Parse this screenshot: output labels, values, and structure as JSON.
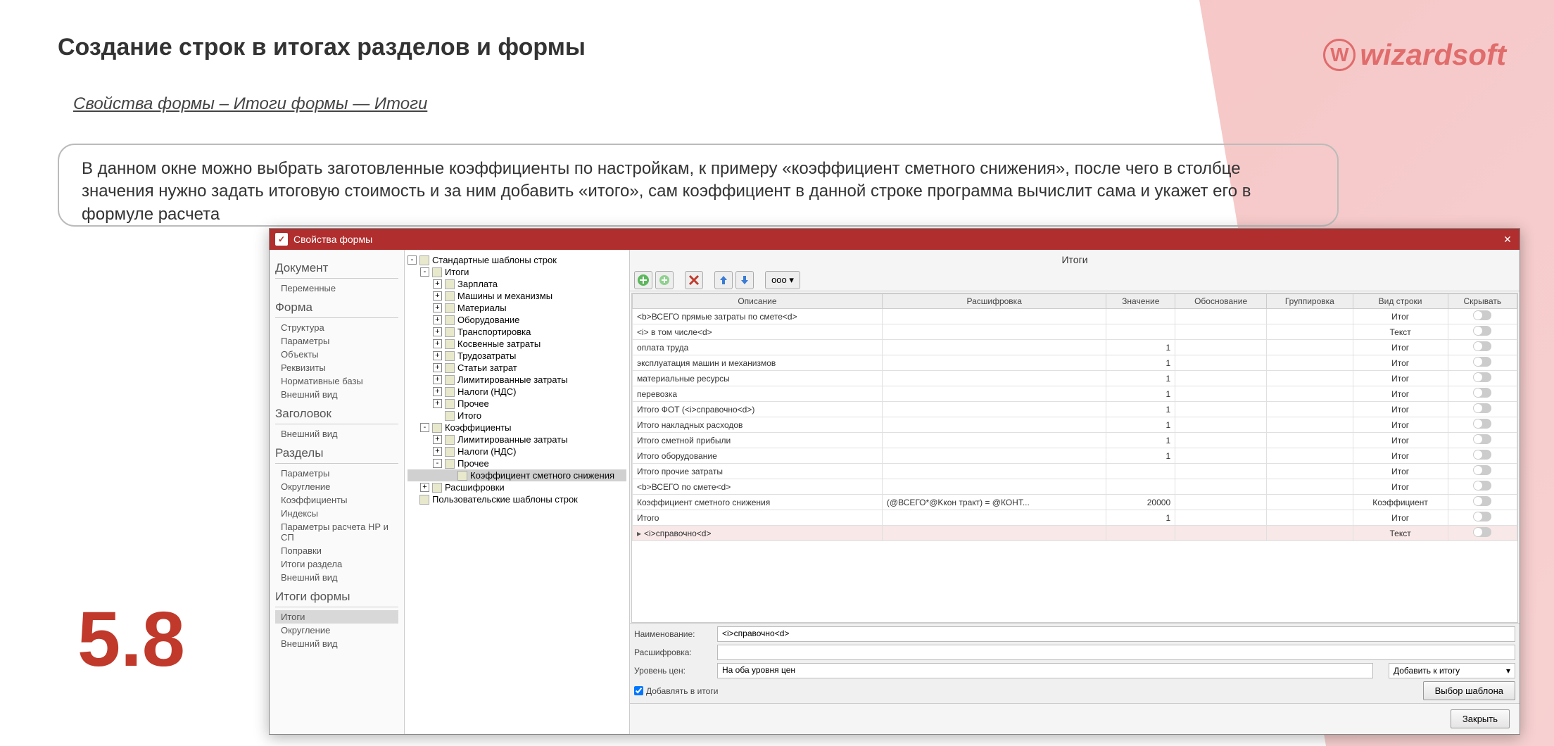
{
  "page": {
    "title": "Создание строк в итогах разделов и формы",
    "breadcrumb": "Свойства формы – Итоги формы — Итоги",
    "logo": "wizardsoft",
    "logo_glyph": "W",
    "description": "В данном окне можно выбрать заготовленные коэффициенты по настройкам, к примеру «коэффициент сметного снижения», после чего в столбце значения нужно задать  итоговую стоимость и за ним добавить «итого», сам коэффициент в данной строке программа вычислит сама и укажет его в формуле расчета",
    "step_number": "5.8"
  },
  "dialog": {
    "title": "Свойства формы",
    "nav": {
      "sections": [
        {
          "heading": "Документ",
          "items": [
            "Переменные"
          ]
        },
        {
          "heading": "Форма",
          "items": [
            "Структура",
            "Параметры",
            "Объекты",
            "Реквизиты",
            "Нормативные базы",
            "Внешний вид"
          ]
        },
        {
          "heading": "Заголовок",
          "items": [
            "Внешний вид"
          ]
        },
        {
          "heading": "Разделы",
          "items": [
            "Параметры",
            "Округление",
            "Коэффициенты",
            "Индексы",
            "Параметры расчета НР и СП",
            "   Поправки",
            "Итоги раздела",
            "Внешний вид"
          ]
        },
        {
          "heading": "Итоги формы",
          "items": [
            "Итоги",
            "Округление",
            "Внешний вид"
          ],
          "selected": "Итоги"
        }
      ]
    },
    "tree": [
      {
        "lvl": 0,
        "toggle": "-",
        "label": "Стандартные шаблоны строк"
      },
      {
        "lvl": 1,
        "toggle": "-",
        "label": "Итоги"
      },
      {
        "lvl": 2,
        "toggle": "+",
        "label": "Зарплата"
      },
      {
        "lvl": 2,
        "toggle": "+",
        "label": "Машины и механизмы"
      },
      {
        "lvl": 2,
        "toggle": "+",
        "label": "Материалы"
      },
      {
        "lvl": 2,
        "toggle": "+",
        "label": "Оборудование"
      },
      {
        "lvl": 2,
        "toggle": "+",
        "label": "Транспортировка"
      },
      {
        "lvl": 2,
        "toggle": "+",
        "label": "Косвенные затраты"
      },
      {
        "lvl": 2,
        "toggle": "+",
        "label": "Трудозатраты"
      },
      {
        "lvl": 2,
        "toggle": "+",
        "label": "Статьи затрат"
      },
      {
        "lvl": 2,
        "toggle": "+",
        "label": "Лимитированные затраты"
      },
      {
        "lvl": 2,
        "toggle": "+",
        "label": "Налоги (НДС)"
      },
      {
        "lvl": 2,
        "toggle": "+",
        "label": "Прочее"
      },
      {
        "lvl": 2,
        "toggle": "",
        "label": "Итого"
      },
      {
        "lvl": 1,
        "toggle": "-",
        "label": "Коэффициенты"
      },
      {
        "lvl": 2,
        "toggle": "+",
        "label": "Лимитированные затраты"
      },
      {
        "lvl": 2,
        "toggle": "+",
        "label": "Налоги (НДС)"
      },
      {
        "lvl": 2,
        "toggle": "-",
        "label": "Прочее"
      },
      {
        "lvl": 3,
        "toggle": "",
        "label": "Коэффициент сметного снижения",
        "hl": true
      },
      {
        "lvl": 1,
        "toggle": "+",
        "label": "Расшифровки"
      },
      {
        "lvl": 0,
        "toggle": "",
        "label": "Пользовательские шаблоны строк"
      }
    ],
    "main": {
      "title": "Итоги",
      "toolbar_ellipsis": "ooo ▾",
      "columns": [
        "Описание",
        "Расшифровка",
        "Значение",
        "Обоснование",
        "Группировка",
        "Вид строки",
        "Скрывать"
      ],
      "rows": [
        {
          "desc": "<b>ВСЕГО прямые затраты по смете<d>",
          "val": "",
          "group": "",
          "kind": "Итог"
        },
        {
          "desc": "<i>   в том числе<d>",
          "val": "",
          "group": "",
          "kind": "Текст"
        },
        {
          "desc": "оплата труда",
          "val": "1",
          "group": "",
          "kind": "Итог"
        },
        {
          "desc": "эксплуатация машин и механизмов",
          "val": "1",
          "group": "",
          "kind": "Итог"
        },
        {
          "desc": "материальные ресурсы",
          "val": "1",
          "group": "",
          "kind": "Итог"
        },
        {
          "desc": "перевозка",
          "val": "1",
          "group": "",
          "kind": "Итог"
        },
        {
          "desc": "Итого ФОТ (<i>справочно<d>)",
          "val": "1",
          "group": "",
          "kind": "Итог"
        },
        {
          "desc": "Итого накладных расходов",
          "val": "1",
          "group": "",
          "kind": "Итог"
        },
        {
          "desc": "Итого сметной прибыли",
          "val": "1",
          "group": "",
          "kind": "Итог"
        },
        {
          "desc": "Итого оборудование",
          "val": "1",
          "group": "",
          "kind": "Итог"
        },
        {
          "desc": "Итого прочие затраты",
          "val": "",
          "group": "",
          "kind": "Итог"
        },
        {
          "desc": "<b>ВСЕГО по смете<d>",
          "val": "",
          "group": "",
          "kind": "Итог"
        },
        {
          "desc": "Коэффициент сметного снижения",
          "ras": "(@ВСЕГО*@Kкон тракт) = @КОНТ...",
          "val": "20000",
          "group": "",
          "kind": "Коэффициент"
        },
        {
          "desc": "Итого",
          "val": "1",
          "group": "",
          "kind": "Итог"
        },
        {
          "desc": "<i>справочно<d>",
          "val": "",
          "group": "",
          "kind": "Текст",
          "mark": true,
          "sel": true
        }
      ],
      "form": {
        "name_label": "Наименование:",
        "name_value": "<i>справочно<d>",
        "decode_label": "Расшифровка:",
        "decode_value": "",
        "pricelevel_label": "Уровень цен:",
        "pricelevel_value": "На оба уровня цен",
        "add_to_totals_label": "Добавлять в итоги",
        "add_to_total_dd": "Добавить к итогу"
      },
      "btn_template": "Выбор шаблона",
      "btn_close": "Закрыть"
    }
  }
}
